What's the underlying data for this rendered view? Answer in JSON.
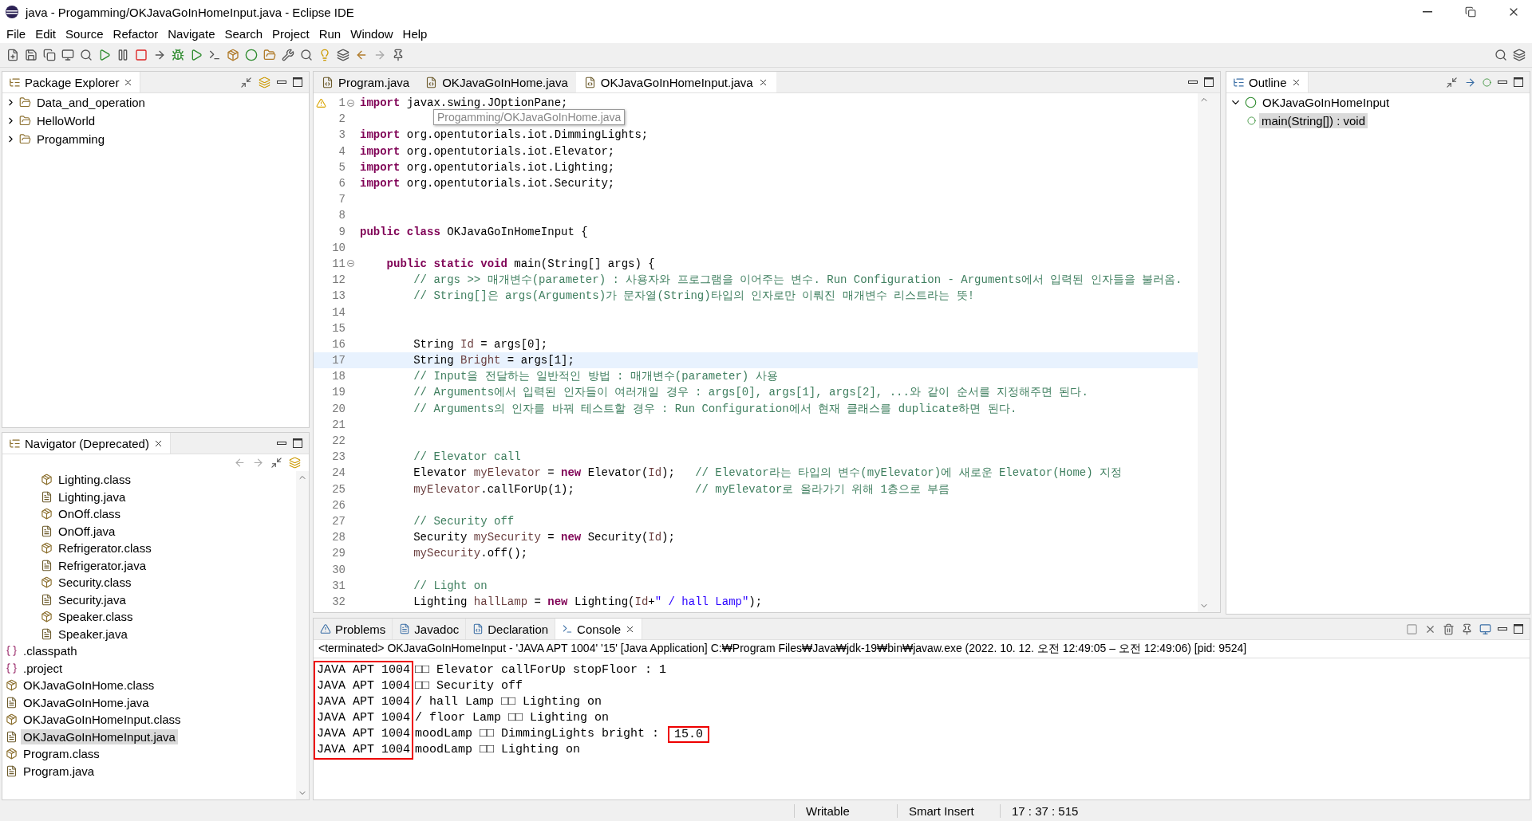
{
  "window": {
    "title": "java - Progamming/OKJavaGoInHomeInput.java - Eclipse IDE"
  },
  "menu": [
    "File",
    "Edit",
    "Source",
    "Refactor",
    "Navigate",
    "Search",
    "Project",
    "Run",
    "Window",
    "Help"
  ],
  "package_explorer": {
    "title": "Package Explorer",
    "items": [
      {
        "label": "Data_and_operation",
        "expanded": false
      },
      {
        "label": "HelloWorld",
        "expanded": false
      },
      {
        "label": "Progamming",
        "expanded": false
      }
    ]
  },
  "navigator": {
    "title": "Navigator (Deprecated)",
    "items": [
      {
        "children": [
          {
            "label": "Lighting.class",
            "kind": "class",
            "selected": false
          },
          {
            "label": "Lighting.java",
            "kind": "java",
            "selected": false
          },
          {
            "label": "OnOff.class",
            "kind": "class",
            "selected": false
          },
          {
            "label": "OnOff.java",
            "kind": "java",
            "selected": false
          },
          {
            "label": "Refrigerator.class",
            "kind": "class",
            "selected": false
          },
          {
            "label": "Refrigerator.java",
            "kind": "java",
            "selected": false
          },
          {
            "label": "Security.class",
            "kind": "class",
            "selected": false
          },
          {
            "label": "Security.java",
            "kind": "java",
            "selected": false
          },
          {
            "label": "Speaker.class",
            "kind": "class",
            "selected": false
          },
          {
            "label": "Speaker.java",
            "kind": "java",
            "selected": false
          }
        ]
      },
      {
        "label": ".classpath",
        "kind": "config",
        "selected": false
      },
      {
        "label": ".project",
        "kind": "config",
        "selected": false
      },
      {
        "label": "OKJavaGoInHome.class",
        "kind": "class",
        "selected": false
      },
      {
        "label": "OKJavaGoInHome.java",
        "kind": "java",
        "selected": false
      },
      {
        "label": "OKJavaGoInHomeInput.class",
        "kind": "class",
        "selected": false
      },
      {
        "label": "OKJavaGoInHomeInput.java",
        "kind": "java",
        "selected": true
      },
      {
        "label": "Program.class",
        "kind": "class",
        "selected": false
      },
      {
        "label": "Program.java",
        "kind": "java",
        "selected": false
      }
    ]
  },
  "editor": {
    "tabs": [
      {
        "label": "Program.java",
        "selected": false
      },
      {
        "label": "OKJavaGoInHome.java",
        "selected": false
      },
      {
        "label": "OKJavaGoInHomeInput.java",
        "selected": true
      }
    ],
    "tooltip": "Progamming/OKJavaGoInHome.java",
    "lines": [
      {
        "number": "1",
        "warning": true,
        "fold": true,
        "tokens": [
          {
            "kind": "keyword",
            "text": "import"
          },
          {
            "kind": "plain",
            "text": " javax.swing.JOptionPane;"
          }
        ]
      },
      {
        "number": "2"
      },
      {
        "number": "3",
        "tokens": [
          {
            "kind": "keyword",
            "text": "import"
          },
          {
            "kind": "plain",
            "text": " org.opentutorials.iot.DimmingLights;"
          }
        ]
      },
      {
        "number": "4",
        "tokens": [
          {
            "kind": "keyword",
            "text": "import"
          },
          {
            "kind": "plain",
            "text": " org.opentutorials.iot.Elevator;"
          }
        ]
      },
      {
        "number": "5",
        "tokens": [
          {
            "kind": "keyword",
            "text": "import"
          },
          {
            "kind": "plain",
            "text": " org.opentutorials.iot.Lighting;"
          }
        ]
      },
      {
        "number": "6",
        "tokens": [
          {
            "kind": "keyword",
            "text": "import"
          },
          {
            "kind": "plain",
            "text": " org.opentutorials.iot.Security;"
          }
        ]
      },
      {
        "number": "7"
      },
      {
        "number": "8"
      },
      {
        "number": "9",
        "tokens": [
          {
            "kind": "keyword",
            "text": "public class"
          },
          {
            "kind": "plain",
            "text": " OKJavaGoInHomeInput {"
          }
        ]
      },
      {
        "number": "10"
      },
      {
        "number": "11",
        "fold": true,
        "tokens": [
          {
            "kind": "keyword",
            "text": "    public static void"
          },
          {
            "kind": "plain",
            "text": " main(String[] args) {"
          }
        ]
      },
      {
        "number": "12",
        "tokens": [
          {
            "kind": "comment",
            "text": "        // args >> 매개변수(parameter) : 사용자와 프로그램을 이어주는 변수. Run Configuration - Arguments에서 입력된 인자들을 불러옴."
          }
        ]
      },
      {
        "number": "13",
        "tokens": [
          {
            "kind": "comment",
            "text": "        // String[]은 args(Arguments)가 문자열(String)타입의 인자로만 이뤄진 매개변수 리스트라는 뜻!"
          }
        ]
      },
      {
        "number": "14"
      },
      {
        "number": "15"
      },
      {
        "number": "16",
        "tokens": [
          {
            "kind": "plain",
            "text": "        String "
          },
          {
            "kind": "variable",
            "text": "Id"
          },
          {
            "kind": "plain",
            "text": " = args[0];"
          }
        ]
      },
      {
        "number": "17",
        "current": true,
        "tokens": [
          {
            "kind": "plain",
            "text": "        String "
          },
          {
            "kind": "variable",
            "text": "Bright"
          },
          {
            "kind": "plain",
            "text": " = args[1];"
          }
        ]
      },
      {
        "number": "18",
        "tokens": [
          {
            "kind": "comment",
            "text": "        // Input을 전달하는 일반적인 방법 : 매개변수(parameter) 사용"
          }
        ]
      },
      {
        "number": "19",
        "tokens": [
          {
            "kind": "comment",
            "text": "        // Arguments에서 입력된 인자들이 여러개일 경우 : args[0], args[1], args[2], ...와 같이 순서를 지정해주면 된다."
          }
        ]
      },
      {
        "number": "20",
        "tokens": [
          {
            "kind": "comment",
            "text": "        // Arguments의 인자를 바꿔 테스트할 경우 : Run Configuration에서 현재 클래스를 duplicate하면 된다."
          }
        ]
      },
      {
        "number": "21"
      },
      {
        "number": "22"
      },
      {
        "number": "23",
        "tokens": [
          {
            "kind": "comment",
            "text": "        // Elevator call"
          }
        ]
      },
      {
        "number": "24",
        "tokens": [
          {
            "kind": "plain",
            "text": "        Elevator "
          },
          {
            "kind": "variable",
            "text": "myElevator"
          },
          {
            "kind": "plain",
            "text": " = "
          },
          {
            "kind": "keyword",
            "text": "new"
          },
          {
            "kind": "plain",
            "text": " Elevator("
          },
          {
            "kind": "variable",
            "text": "Id"
          },
          {
            "kind": "plain",
            "text": ");   "
          },
          {
            "kind": "comment",
            "text": "// Elevator라는 타입의 변수(myElevator)에 새로운 Elevator(Home) 지정"
          }
        ]
      },
      {
        "number": "25",
        "tokens": [
          {
            "kind": "variable",
            "text": "        myElevator"
          },
          {
            "kind": "plain",
            "text": ".callForUp(1);                  "
          },
          {
            "kind": "comment",
            "text": "// myElevator로 올라가기 위해 1층으로 부름"
          }
        ]
      },
      {
        "number": "26"
      },
      {
        "number": "27",
        "tokens": [
          {
            "kind": "comment",
            "text": "        // Security off"
          }
        ]
      },
      {
        "number": "28",
        "tokens": [
          {
            "kind": "plain",
            "text": "        Security "
          },
          {
            "kind": "variable",
            "text": "mySecurity"
          },
          {
            "kind": "plain",
            "text": " = "
          },
          {
            "kind": "keyword",
            "text": "new"
          },
          {
            "kind": "plain",
            "text": " Security("
          },
          {
            "kind": "variable",
            "text": "Id"
          },
          {
            "kind": "plain",
            "text": ");"
          }
        ]
      },
      {
        "number": "29",
        "tokens": [
          {
            "kind": "variable",
            "text": "        mySecurity"
          },
          {
            "kind": "plain",
            "text": ".off();"
          }
        ]
      },
      {
        "number": "30"
      },
      {
        "number": "31",
        "tokens": [
          {
            "kind": "comment",
            "text": "        // Light on"
          }
        ]
      },
      {
        "number": "32",
        "tokens": [
          {
            "kind": "plain",
            "text": "        Lighting "
          },
          {
            "kind": "variable",
            "text": "hallLamp"
          },
          {
            "kind": "plain",
            "text": " = "
          },
          {
            "kind": "keyword",
            "text": "new"
          },
          {
            "kind": "plain",
            "text": " Lighting("
          },
          {
            "kind": "variable",
            "text": "Id"
          },
          {
            "kind": "plain",
            "text": "+"
          },
          {
            "kind": "string",
            "text": "\" / hall Lamp\""
          },
          {
            "kind": "plain",
            "text": ");"
          }
        ]
      }
    ]
  },
  "outline": {
    "title": "Outline",
    "items": [
      {
        "label": "OKJavaGoInHomeInput",
        "expanded": true,
        "selected": false,
        "children": [
          {
            "label": "main(String[]) : void",
            "selected": true
          }
        ]
      }
    ]
  },
  "bottom": {
    "tabs": [
      {
        "label": "Problems",
        "selected": false
      },
      {
        "label": "Javadoc",
        "selected": false
      },
      {
        "label": "Declaration",
        "selected": false
      },
      {
        "label": "Console",
        "selected": true
      }
    ],
    "console": {
      "header": "<terminated> OKJavaGoInHomeInput - 'JAVA APT 1004' '15' [Java Application] C:₩Program Files₩Java₩jdk-19₩bin₩javaw.exe  (2022. 10. 12. 오전 12:49:05 – 오전 12:49:06) [pid: 9524]",
      "prefix_boxed": true,
      "lines": [
        {
          "prefix": "JAVA APT 1004",
          "text": "□□ Elevator callForUp stopFloor : 1"
        },
        {
          "prefix": "JAVA APT 1004",
          "text": "□□ Security off"
        },
        {
          "prefix": "JAVA APT 1004",
          "text": "/ hall Lamp □□ Lighting on"
        },
        {
          "prefix": "JAVA APT 1004",
          "text": "/ floor Lamp □□ Lighting on"
        },
        {
          "prefix": "JAVA APT 1004",
          "text": "moodLamp □□ DimmingLights bright : ",
          "value": "15.0",
          "boxed": true
        },
        {
          "prefix": "JAVA APT 1004",
          "text": "moodLamp □□ Lighting on"
        }
      ]
    }
  },
  "status_bar": [
    "Writable",
    "Smart Insert",
    "17 : 37 : 515"
  ]
}
